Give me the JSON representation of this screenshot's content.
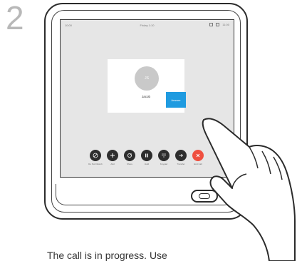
{
  "step": {
    "number": "2"
  },
  "screen": {
    "status_bar": {
      "left_text": "10:00",
      "center_text": "Friday 1:10",
      "right_text": "11:00"
    },
    "call_card": {
      "caller_name": "Jacob",
      "avatar_text": "JS",
      "action_button_label": "Answer"
    },
    "toolbar": {
      "buttons": [
        {
          "label": "Do Not Disturb",
          "icon": "dnd-icon"
        },
        {
          "label": "Add",
          "icon": "plus-icon"
        },
        {
          "label": "Share",
          "icon": "share-icon"
        },
        {
          "label": "Hold",
          "icon": "pause-icon"
        },
        {
          "label": "Keypad",
          "icon": "keypad-icon"
        },
        {
          "label": "Transfer",
          "icon": "transfer-icon"
        },
        {
          "label": "End Call",
          "icon": "end-call-icon"
        }
      ]
    }
  },
  "caption": "The call is in progress. Use"
}
